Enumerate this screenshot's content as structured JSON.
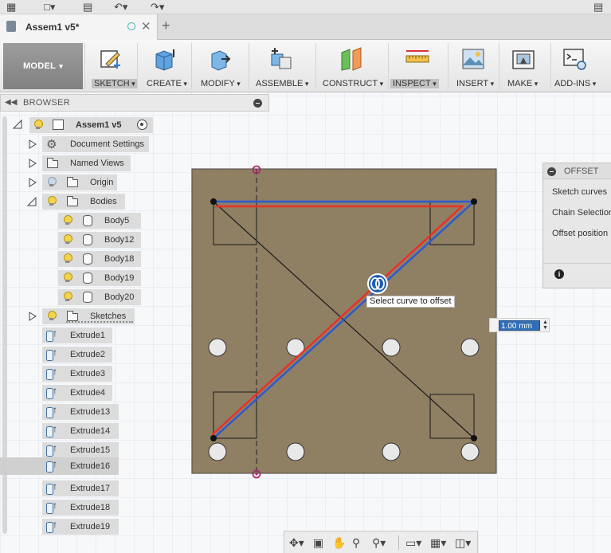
{
  "document": {
    "title": "Assem1 v5*"
  },
  "toolbar": {
    "workspace": "MODEL",
    "groups": [
      {
        "label": "SKETCH",
        "icon": "sketch-icon"
      },
      {
        "label": "CREATE",
        "icon": "create-icon"
      },
      {
        "label": "MODIFY",
        "icon": "modify-icon"
      },
      {
        "label": "ASSEMBLE",
        "icon": "assemble-icon"
      },
      {
        "label": "CONSTRUCT",
        "icon": "construct-icon"
      },
      {
        "label": "INSPECT",
        "icon": "inspect-icon"
      },
      {
        "label": "INSERT",
        "icon": "insert-icon"
      },
      {
        "label": "MAKE",
        "icon": "make-icon"
      },
      {
        "label": "ADD-INS",
        "icon": "add-ins-icon"
      }
    ]
  },
  "browser": {
    "title": "BROWSER",
    "root": "Assem1 v5",
    "nodes": {
      "document_settings": "Document Settings",
      "named_views": "Named Views",
      "origin": "Origin",
      "bodies": "Bodies",
      "sketches": "Sketches"
    },
    "bodies": [
      "Body5",
      "Body12",
      "Body18",
      "Body19",
      "Body20"
    ],
    "features": [
      "Extrude1",
      "Extrude2",
      "Extrude3",
      "Extrude4",
      "Extrude13",
      "Extrude14",
      "Extrude15",
      "Extrude16",
      "Extrude17",
      "Extrude18",
      "Extrude19"
    ]
  },
  "offset_panel": {
    "title": "OFFSET",
    "rows": [
      "Sketch curves",
      "Chain Selection",
      "Offset position"
    ],
    "info_icon": "i"
  },
  "canvas": {
    "tooltip": "Select curve to offset",
    "dimension_value": "1.00 mm",
    "colors": {
      "plate": "#857a66",
      "red_curve": "#e8312b",
      "blue_curve": "#2b5bd1",
      "origin_marker": "#b0276e"
    }
  },
  "navbar": {
    "icons": [
      "orbit-icon",
      "look-at-icon",
      "pan-icon",
      "zoom-icon",
      "zoom-window-icon",
      "display-settings-icon",
      "grid-settings-icon",
      "viewports-icon"
    ]
  }
}
